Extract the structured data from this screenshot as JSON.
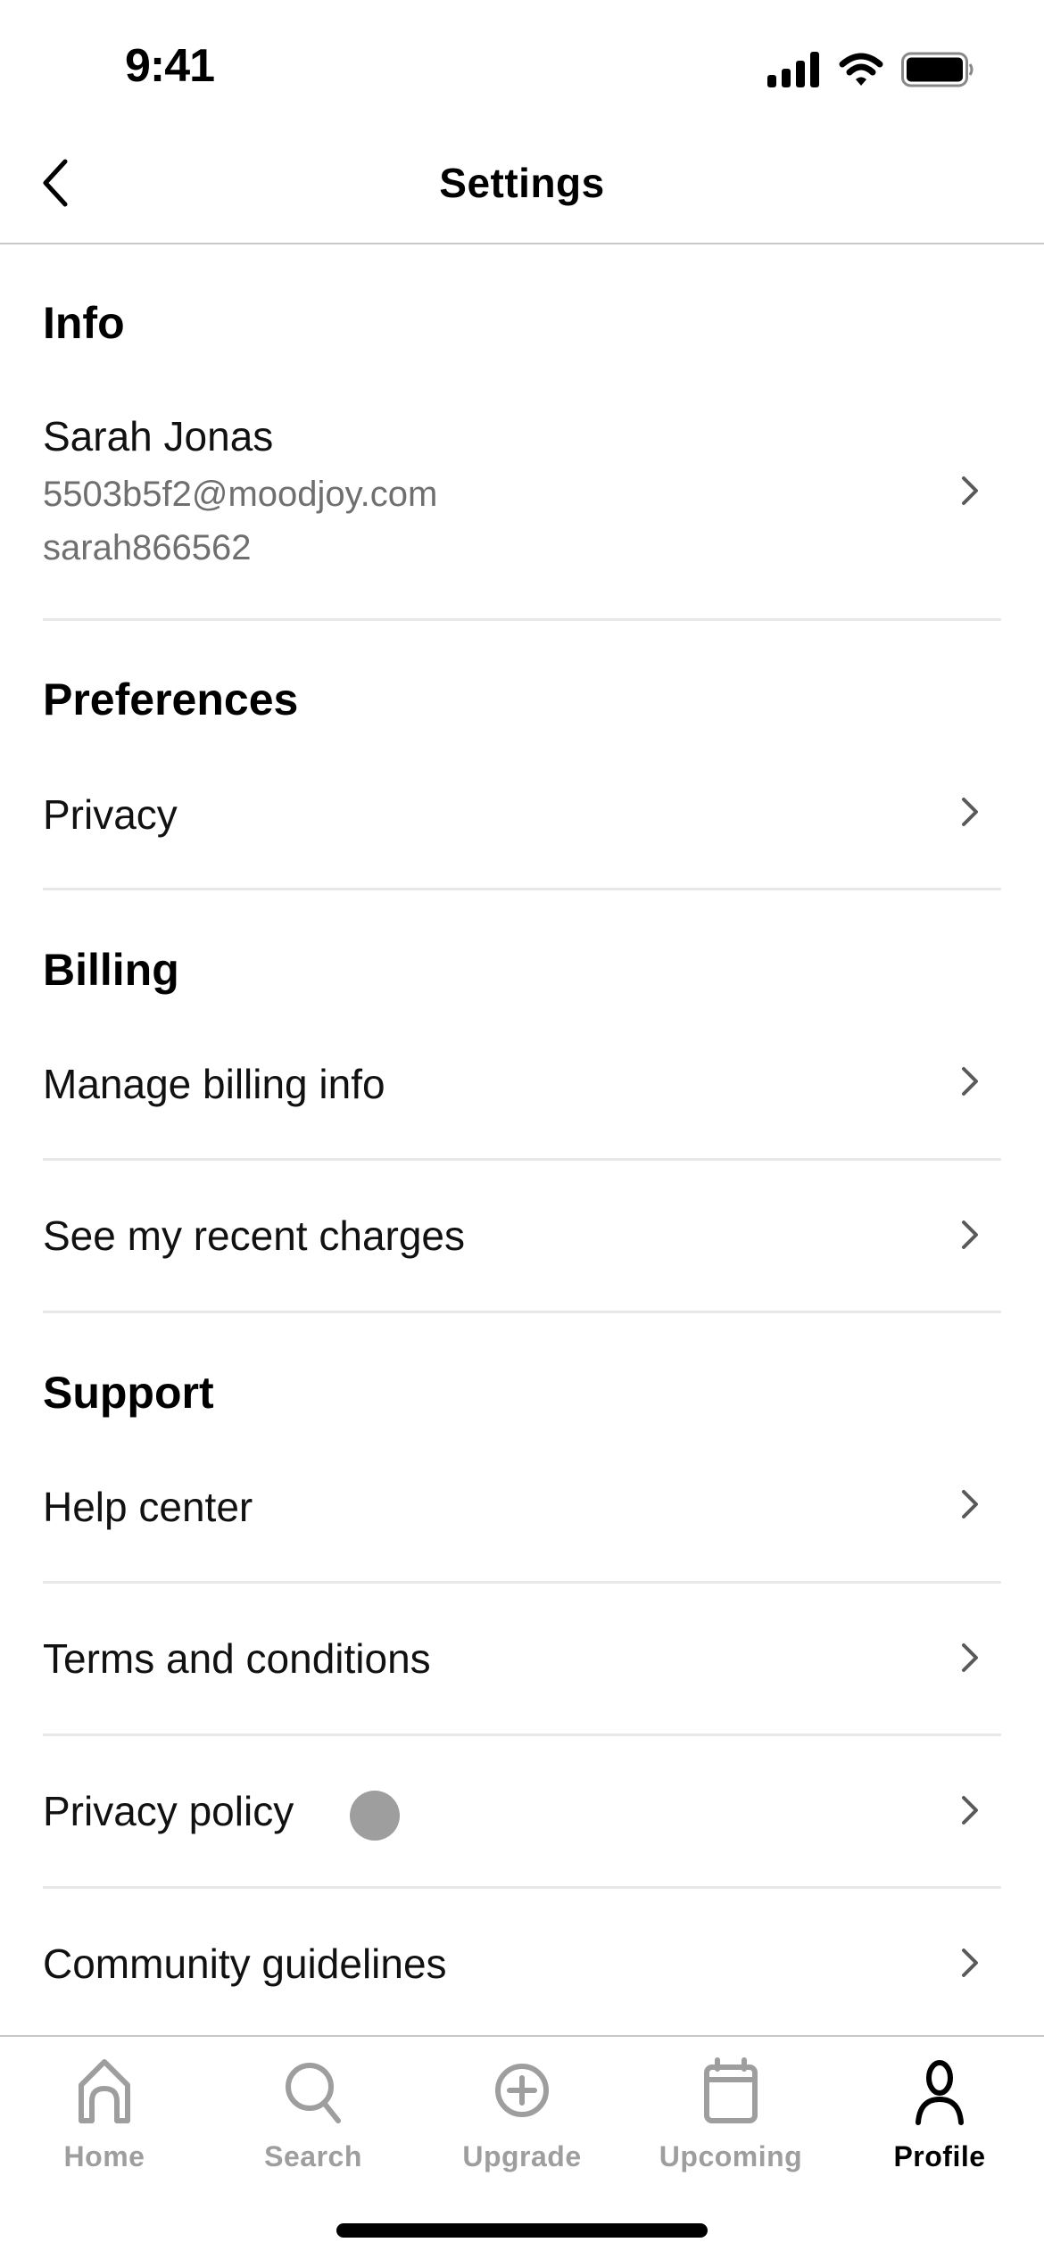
{
  "status_bar": {
    "time": "9:41",
    "icons": [
      "cellular-signal-icon",
      "wifi-icon",
      "battery-icon"
    ]
  },
  "header": {
    "title": "Settings",
    "back_icon": "chevron-left-icon"
  },
  "sections": {
    "info": {
      "heading": "Info",
      "profile": {
        "name": "Sarah Jonas",
        "email": "5503b5f2@moodjoy.com",
        "username": "sarah866562"
      }
    },
    "preferences": {
      "heading": "Preferences",
      "items": [
        {
          "label": "Privacy"
        }
      ]
    },
    "billing": {
      "heading": "Billing",
      "items": [
        {
          "label": "Manage billing info"
        },
        {
          "label": "See my recent charges"
        }
      ]
    },
    "support": {
      "heading": "Support",
      "items": [
        {
          "label": "Help center"
        },
        {
          "label": "Terms and conditions"
        },
        {
          "label": "Privacy policy"
        },
        {
          "label": "Community guidelines"
        }
      ]
    }
  },
  "tab_bar": {
    "tabs": [
      {
        "label": "Home",
        "icon": "home-icon",
        "active": false
      },
      {
        "label": "Search",
        "icon": "search-icon",
        "active": false
      },
      {
        "label": "Upgrade",
        "icon": "plus-circle-icon",
        "active": false
      },
      {
        "label": "Upcoming",
        "icon": "calendar-icon",
        "active": false
      },
      {
        "label": "Profile",
        "icon": "person-icon",
        "active": true
      }
    ]
  },
  "colors": {
    "text_primary": "#000000",
    "text_secondary": "#6f6f6f",
    "tab_inactive": "#9e9e9e",
    "divider": "#e8e8e8",
    "chevron": "#5a5a5a"
  }
}
